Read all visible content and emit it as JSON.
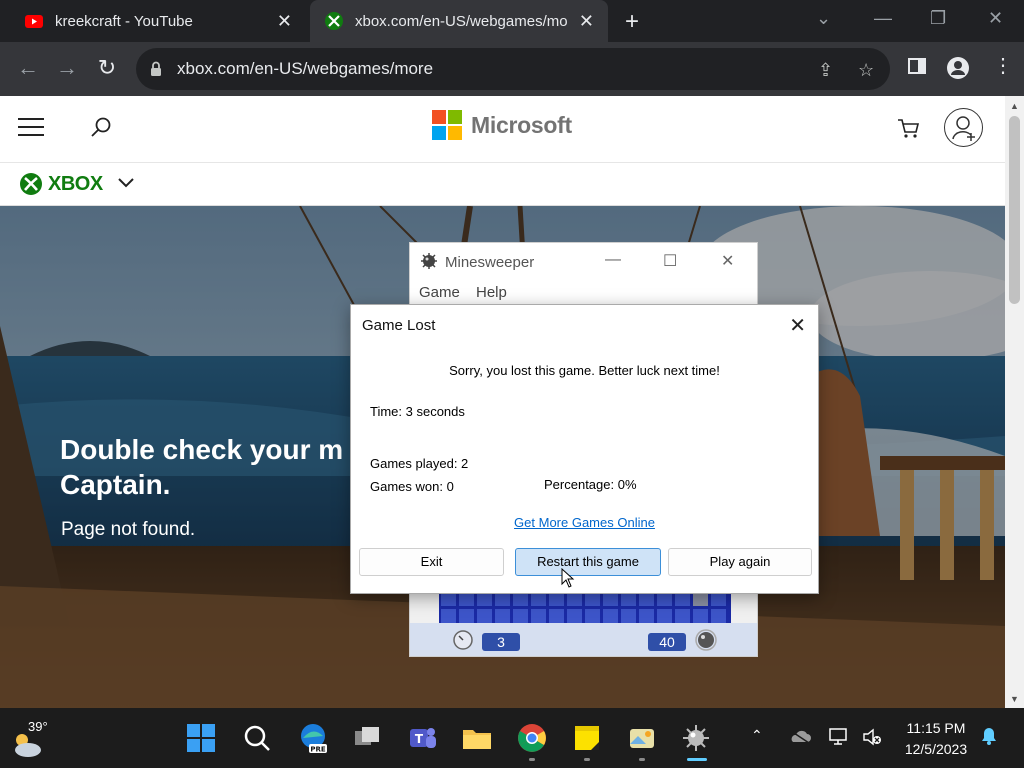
{
  "browser": {
    "tabs": [
      {
        "title": "kreekcraft - YouTube",
        "active": false
      },
      {
        "title": "xbox.com/en-US/webgames/mo",
        "active": true
      }
    ],
    "url": "xbox.com/en-US/webgames/more"
  },
  "site": {
    "brand": "Microsoft",
    "sub_brand": "XBOX",
    "headline": "Double check your m Captain.",
    "headline_line1": "Double check your m",
    "headline_line2": "Captain.",
    "subtext": "Page not found."
  },
  "minesweeper": {
    "title": "Minesweeper",
    "menu": [
      "Game",
      "Help"
    ],
    "time_counter": "3",
    "mine_counter": "40"
  },
  "dialog": {
    "title": "Game Lost",
    "message": "Sorry, you lost this game. Better luck next time!",
    "time": "Time: 3 seconds",
    "games_played": "Games played: 2",
    "games_won": "Games won: 0",
    "percentage": "Percentage: 0%",
    "link": "Get More Games Online",
    "buttons": {
      "exit": "Exit",
      "restart": "Restart this game",
      "play_again": "Play again"
    }
  },
  "taskbar": {
    "temperature": "39°",
    "time": "11:15 PM",
    "date": "12/5/2023",
    "apps": [
      "start-icon",
      "search-icon",
      "edge-pre-icon",
      "task-view-icon",
      "teams-icon",
      "file-explorer-icon",
      "chrome-icon",
      "sticky-notes-icon",
      "photos-icon",
      "minesweeper-icon"
    ]
  },
  "colors": {
    "ms_red": "#f25022",
    "ms_green": "#7fba00",
    "ms_blue": "#00a4ef",
    "ms_yellow": "#ffb900",
    "xbox_green": "#107c10",
    "link_blue": "#0066cc"
  }
}
